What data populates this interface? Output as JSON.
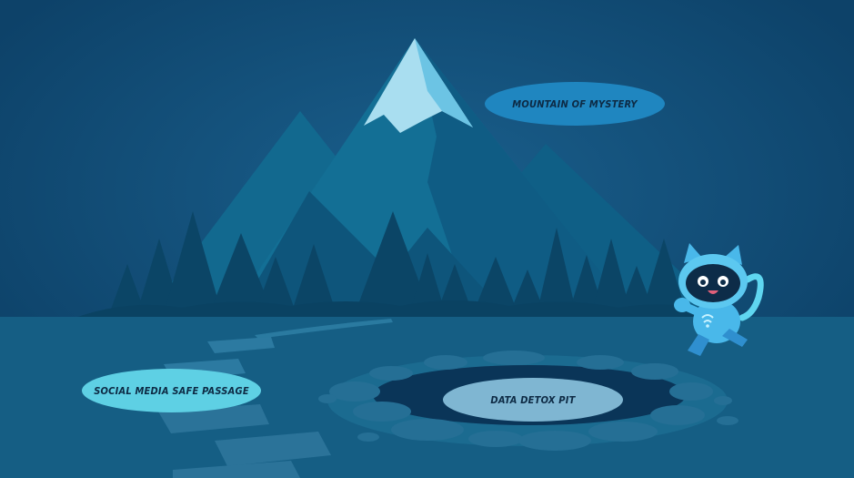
{
  "scene": {
    "background_color": "#0f4a72",
    "ground_color": "#155e84"
  },
  "locations": {
    "mountain": {
      "label": "MOUNTAIN OF MYSTERY",
      "color": "#1f86c0"
    },
    "social": {
      "label": "SOCIAL MEDIA SAFE PASSAGE",
      "color": "#5ed0e4"
    },
    "detox": {
      "label": "DATA DETOX PIT",
      "color": "#7fb6d2"
    }
  },
  "mascot": {
    "name": "robot-cat-mascot",
    "color": "#49b8ea"
  }
}
